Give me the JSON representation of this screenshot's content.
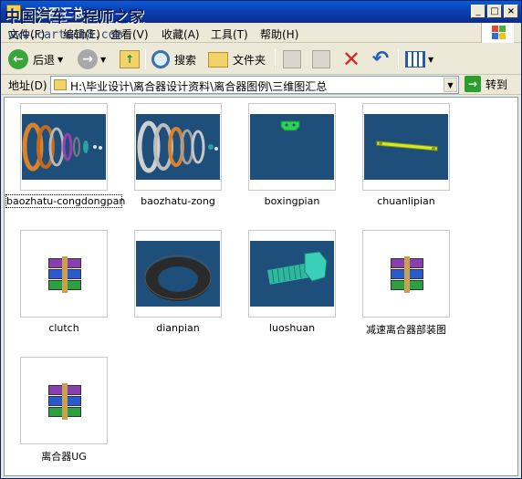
{
  "window": {
    "title": "三维图汇总",
    "watermark": "中国汽车工程师之家",
    "watermark_url": "www.cartech8.com"
  },
  "menu": [
    "文件(F)",
    "编辑(E)",
    "查看(V)",
    "收藏(A)",
    "工具(T)",
    "帮助(H)"
  ],
  "toolbar": {
    "back_label": "后退",
    "search_label": "搜索",
    "folders_label": "文件夹"
  },
  "address": {
    "label": "地址(D)",
    "path": "H:\\毕业设计\\离合器设计资料\\离合器图例\\三维图汇总",
    "go_label": "转到"
  },
  "files": [
    {
      "name": "baozhatu-congdongpan",
      "type": "image",
      "icon": "exploded-driven-disc-thumbnail",
      "selected": true
    },
    {
      "name": "baozhatu-zong",
      "type": "image",
      "icon": "exploded-assembly-thumbnail"
    },
    {
      "name": "boxingpian",
      "type": "image",
      "icon": "wave-spring-thumbnail"
    },
    {
      "name": "chuanlipian",
      "type": "image",
      "icon": "transmission-strap-thumbnail"
    },
    {
      "name": "clutch",
      "type": "archive",
      "icon": "winrar-archive-icon"
    },
    {
      "name": "dianpian",
      "type": "image",
      "icon": "washer-thumbnail"
    },
    {
      "name": "luoshuan",
      "type": "image",
      "icon": "bolt-thumbnail"
    },
    {
      "name": "减速离合器部装图",
      "type": "archive",
      "icon": "winrar-archive-icon"
    },
    {
      "name": "离合器UG",
      "type": "archive",
      "icon": "winrar-archive-icon"
    }
  ],
  "colors": {
    "titlebar": "#0b3fb4",
    "thumb_bg": "#1d4f7a",
    "back_green": "#3aa53a",
    "delete_red": "#d12a1f"
  }
}
